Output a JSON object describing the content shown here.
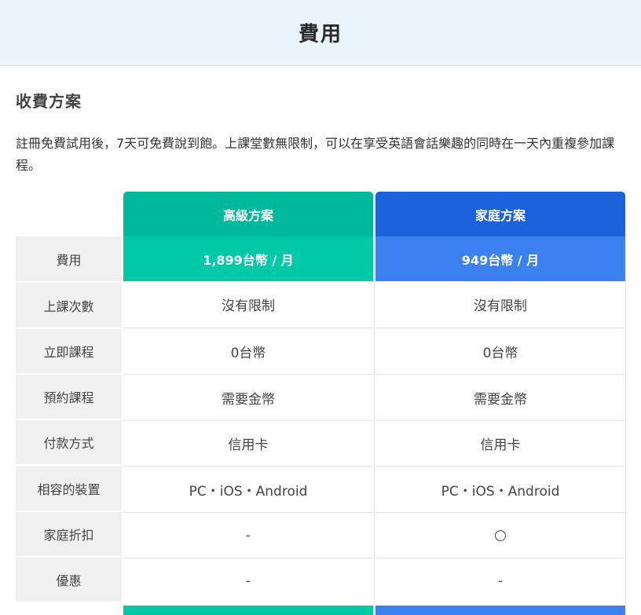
{
  "header": {
    "title": "費用"
  },
  "section": {
    "title": "收費方案",
    "description": "註冊免費試用後，7天可免費說到飽。上課堂數無限制，可以在享受英語會話樂趣的同時在一天內重複參加課程。"
  },
  "plans": [
    {
      "name": "高級方案",
      "price": "1,899台幣 / 月",
      "header_color": "#00b89c",
      "price_color": "#00c9a7"
    },
    {
      "name": "家庭方案",
      "price": "949台幣 / 月",
      "header_color": "#1a62da",
      "price_color": "#3b82f0"
    }
  ],
  "table": {
    "price_label": "費用",
    "rows": [
      {
        "label": "上課次數",
        "values": [
          "沒有限制",
          "沒有限制"
        ]
      },
      {
        "label": "立即課程",
        "values": [
          "0台幣",
          "0台幣"
        ]
      },
      {
        "label": "預約課程",
        "values": [
          "需要金幣",
          "需要金幣"
        ]
      },
      {
        "label": "付款方式",
        "values": [
          "信用卡",
          "信用卡"
        ]
      },
      {
        "label": "相容的裝置",
        "values": [
          "PC・iOS・Android",
          "PC・iOS・Android"
        ]
      },
      {
        "label": "家庭折扣",
        "values": [
          "-",
          ""
        ],
        "icons": [
          "",
          "circle-icon"
        ]
      },
      {
        "label": "優惠",
        "values": [
          "-",
          "-"
        ]
      }
    ]
  }
}
